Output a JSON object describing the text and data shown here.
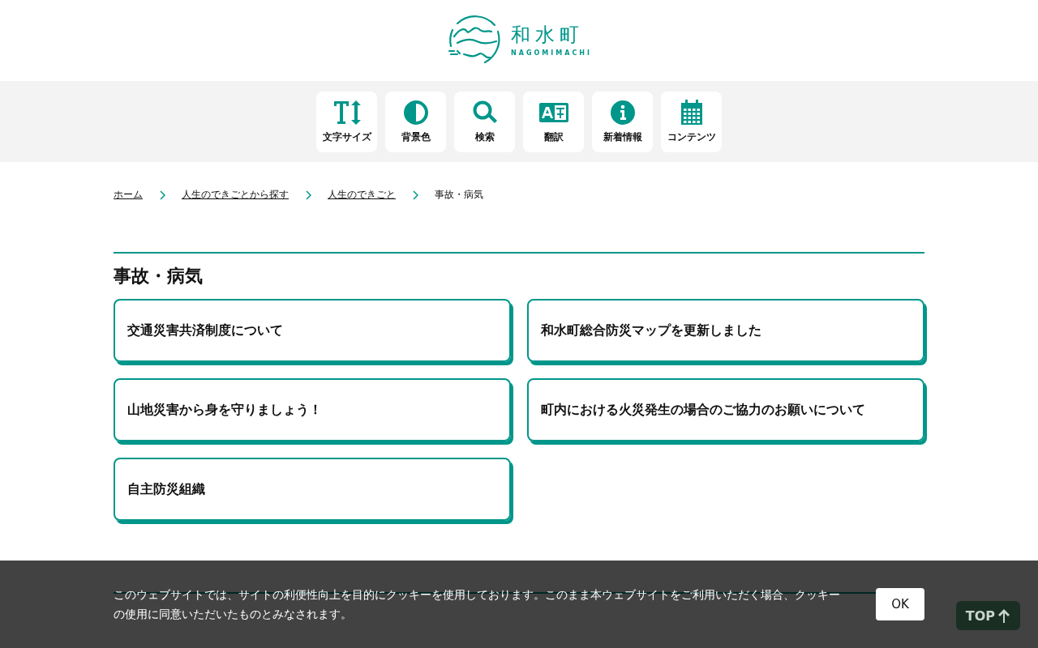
{
  "header": {
    "logo_title": "和水町",
    "logo_subtitle": "NAGOMIMACHI"
  },
  "toolbar": [
    {
      "kind": "textsize",
      "label": "文字サイズ"
    },
    {
      "kind": "contrast",
      "label": "背景色"
    },
    {
      "kind": "search",
      "label": "検索"
    },
    {
      "kind": "translate",
      "label": "翻訳"
    },
    {
      "kind": "info",
      "label": "新着情報"
    },
    {
      "kind": "calendar",
      "label": "コンテンツ"
    }
  ],
  "breadcrumbs": [
    {
      "label": "ホーム",
      "link": true
    },
    {
      "label": "人生のできごとから探す",
      "link": true
    },
    {
      "label": "人生のできごと",
      "link": true
    },
    {
      "label": "事故・病気",
      "link": false
    }
  ],
  "section": {
    "title": "事故・病気",
    "cards": [
      "交通災害共済制度について",
      "和水町総合防災マップを更新しました",
      "山地災害から身を守りましょう！",
      "町内における火災発生の場合のご協力のお願いについて",
      "自主防災組織"
    ]
  },
  "cookie_banner": {
    "text": "このウェブサイトでは、サイトの利便性向上を目的にクッキーを使用しております。このまま本ウェブサイトをご利用いただく場合、クッキーの使用に同意いただいたものとみなされます。",
    "button": "OK"
  },
  "top_button": {
    "label": "TOP"
  }
}
